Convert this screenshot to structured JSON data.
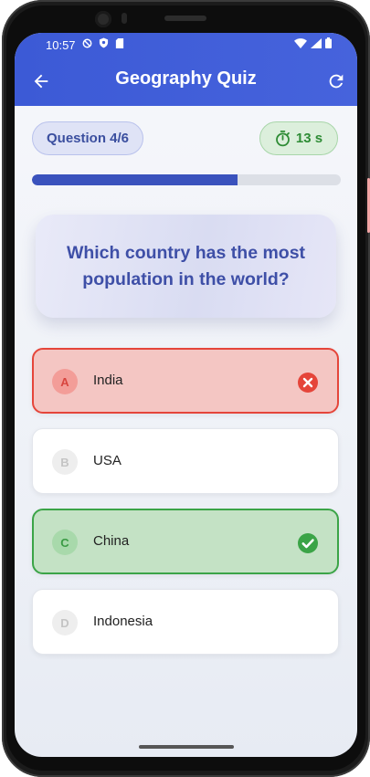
{
  "status_bar": {
    "time": "10:57"
  },
  "app_bar": {
    "title": "Geography Quiz"
  },
  "quiz": {
    "question_counter": "Question 4/6",
    "timer": "13 s",
    "progress_fraction": 0.667,
    "question": "Which country has the most population in the world?",
    "options": [
      {
        "letter": "A",
        "label": "India",
        "state": "wrong"
      },
      {
        "letter": "B",
        "label": "USA",
        "state": "default"
      },
      {
        "letter": "C",
        "label": "China",
        "state": "correct"
      },
      {
        "letter": "D",
        "label": "Indonesia",
        "state": "default"
      }
    ]
  },
  "colors": {
    "app_bar": "#3e5bd6",
    "progress": "#3a52bd",
    "wrong": "#e5453a",
    "correct": "#3ba447"
  }
}
